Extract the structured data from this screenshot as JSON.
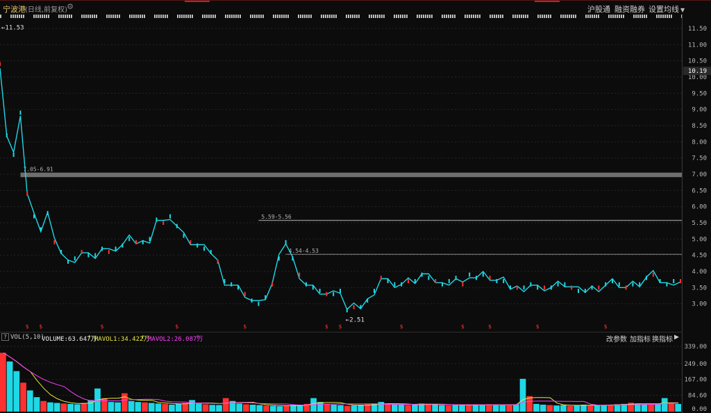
{
  "header": {
    "stock_name": "宁波港",
    "mode": "(日线,前复权)",
    "links": {
      "hugang": "沪股通",
      "rzrq": "融资融券",
      "setup": "设置均线"
    }
  },
  "price_axis": {
    "ticks": [
      "11.50",
      "11.00",
      "10.50",
      "10.00",
      "9.50",
      "9.00",
      "8.50",
      "8.00",
      "7.50",
      "7.00",
      "6.50",
      "6.00",
      "5.50",
      "5.00",
      "4.50",
      "4.00",
      "3.50",
      "3.00"
    ],
    "current_price": "10.19"
  },
  "annotations": {
    "high_marker": "11.53",
    "low_marker": "2.51",
    "levels": [
      {
        "label": "7.05-6.91",
        "low": 6.91,
        "high": 7.05
      },
      {
        "label": "5.59-5.56",
        "low": 5.56,
        "high": 5.59
      },
      {
        "label": "4.54-4.53",
        "low": 4.53,
        "high": 4.54
      }
    ],
    "marker_symbol": "$"
  },
  "volume": {
    "indicator": "VOL(5,10)",
    "volume_label": "VOLUME:63.647万",
    "mavol1_label": "MAVOL1:34.422万",
    "mavol2_label": "MAVOL2:26.087万",
    "axis_ticks": [
      "339.00",
      "249.00",
      "167.00",
      "84.60",
      "0.00"
    ],
    "buttons": {
      "params": "改参数",
      "add": "加指标",
      "change": "换指标"
    }
  },
  "colors": {
    "candle": "#1fd8e6",
    "down": "#ff3030",
    "ma1": "#e8e840",
    "ma2": "#ff40ff",
    "level_band": "#b4b4b4",
    "accent_red": "#c62020"
  },
  "chart_data": {
    "type": "line",
    "title": "",
    "xlabel": "",
    "ylabel": "",
    "ylim": [
      2.2,
      11.8
    ],
    "series": [
      {
        "values": [
          10.4,
          8.2,
          7.6,
          8.9,
          6.4,
          5.7,
          5.3,
          5.8,
          4.9,
          4.6,
          4.3,
          4.4,
          4.6,
          4.5,
          4.5,
          4.7,
          4.6,
          4.7,
          4.8,
          5.0,
          4.9,
          4.9,
          5.0,
          5.6,
          5.5,
          5.7,
          5.4,
          5.1,
          4.9,
          4.8,
          4.7,
          4.6,
          4.3,
          3.7,
          3.6,
          3.5,
          3.3,
          3.1,
          3.0,
          3.2,
          3.6,
          4.4,
          4.9,
          4.4,
          3.9,
          3.6,
          3.5,
          3.4,
          3.3,
          3.3,
          3.4,
          2.8,
          2.9,
          2.9,
          3.1,
          3.4,
          3.8,
          3.7,
          3.6,
          3.6,
          3.7,
          3.7,
          3.9,
          3.8,
          3.7,
          3.6,
          3.7,
          3.8,
          3.6,
          3.9,
          3.8,
          3.9,
          3.8,
          3.7,
          3.7,
          3.5,
          3.5,
          3.5,
          3.6,
          3.5,
          3.5,
          3.5,
          3.6,
          3.6,
          3.5,
          3.4,
          3.4,
          3.5,
          3.5,
          3.6,
          3.7,
          3.6,
          3.5,
          3.6,
          3.6,
          3.8,
          3.9,
          3.7,
          3.6,
          3.7,
          3.7
        ]
      }
    ],
    "volume_values": [
      305,
      260,
      210,
      150,
      110,
      75,
      55,
      48,
      45,
      42,
      40,
      38,
      45,
      60,
      120,
      70,
      50,
      48,
      95,
      55,
      50,
      48,
      45,
      42,
      40,
      36,
      40,
      45,
      60,
      42,
      38,
      35,
      34,
      70,
      55,
      42,
      38,
      36,
      34,
      32,
      30,
      28,
      30,
      34,
      36,
      40,
      70,
      50,
      40,
      36,
      34,
      30,
      32,
      36,
      38,
      42,
      50,
      40,
      36,
      36,
      34,
      38,
      42,
      38,
      36,
      34,
      32,
      34,
      36,
      34,
      36,
      35,
      38,
      36,
      34,
      36,
      38,
      170,
      80,
      40,
      36,
      34,
      32,
      34,
      30,
      32,
      36,
      34,
      32,
      34,
      36,
      38,
      40,
      46,
      42,
      38,
      36,
      40,
      70,
      45,
      40
    ]
  }
}
